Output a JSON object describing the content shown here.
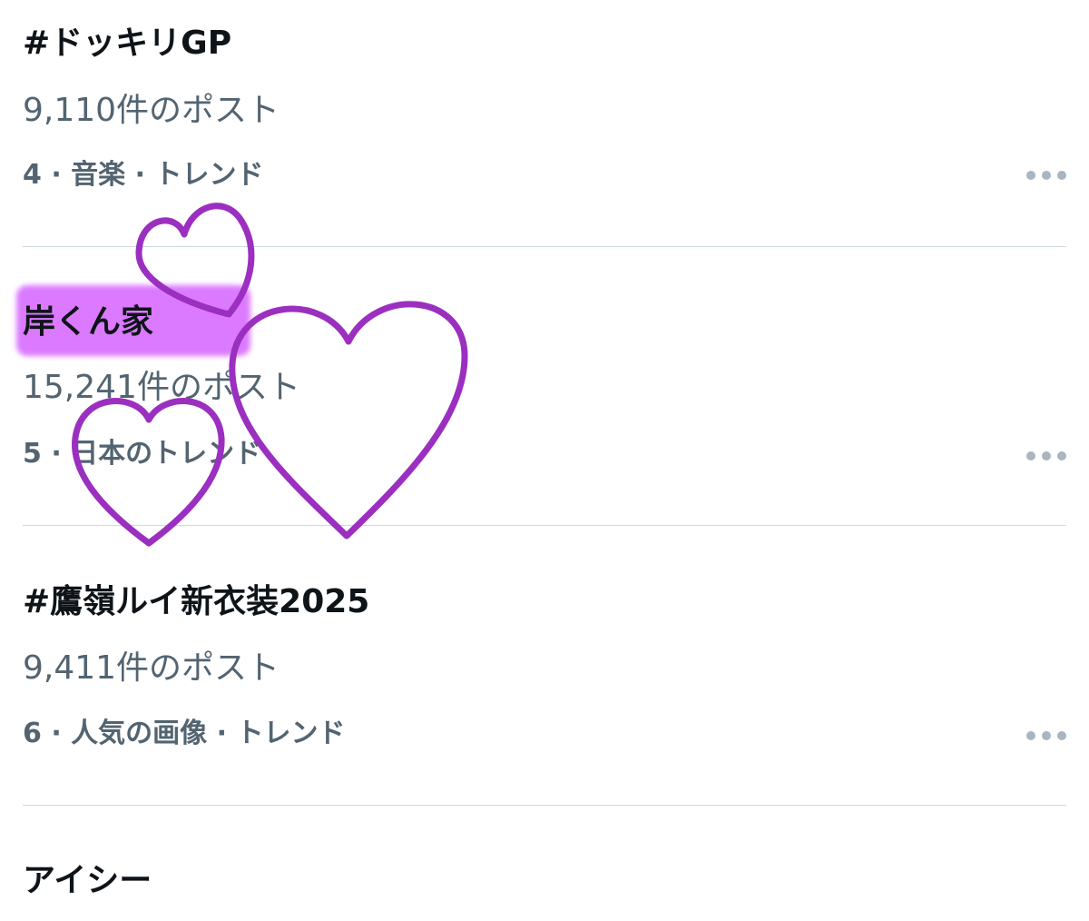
{
  "trends": [
    {
      "title": "#ドッキリGP",
      "post_count": "9,110件のポスト",
      "context": "4 · 音楽 · トレンド",
      "more_label": "•••"
    },
    {
      "title": "岸くん家",
      "post_count": "15,241件のポスト",
      "context": "5 · 日本のトレンド",
      "more_label": "•••"
    },
    {
      "title": "#鷹嶺ルイ新衣装2025",
      "post_count": "9,411件のポスト",
      "context": "6 · 人気の画像 · トレンド",
      "more_label": "•••"
    },
    {
      "title": "アイシー"
    }
  ],
  "annotations": {
    "highlight_color": "#da73ff",
    "heart_color": "#9b2fc0",
    "heart_count": 3
  },
  "colors": {
    "title_text": "#0f1419",
    "secondary_text": "#536471",
    "divider": "#cfd9de",
    "more_dots": "#a9b5c0"
  }
}
